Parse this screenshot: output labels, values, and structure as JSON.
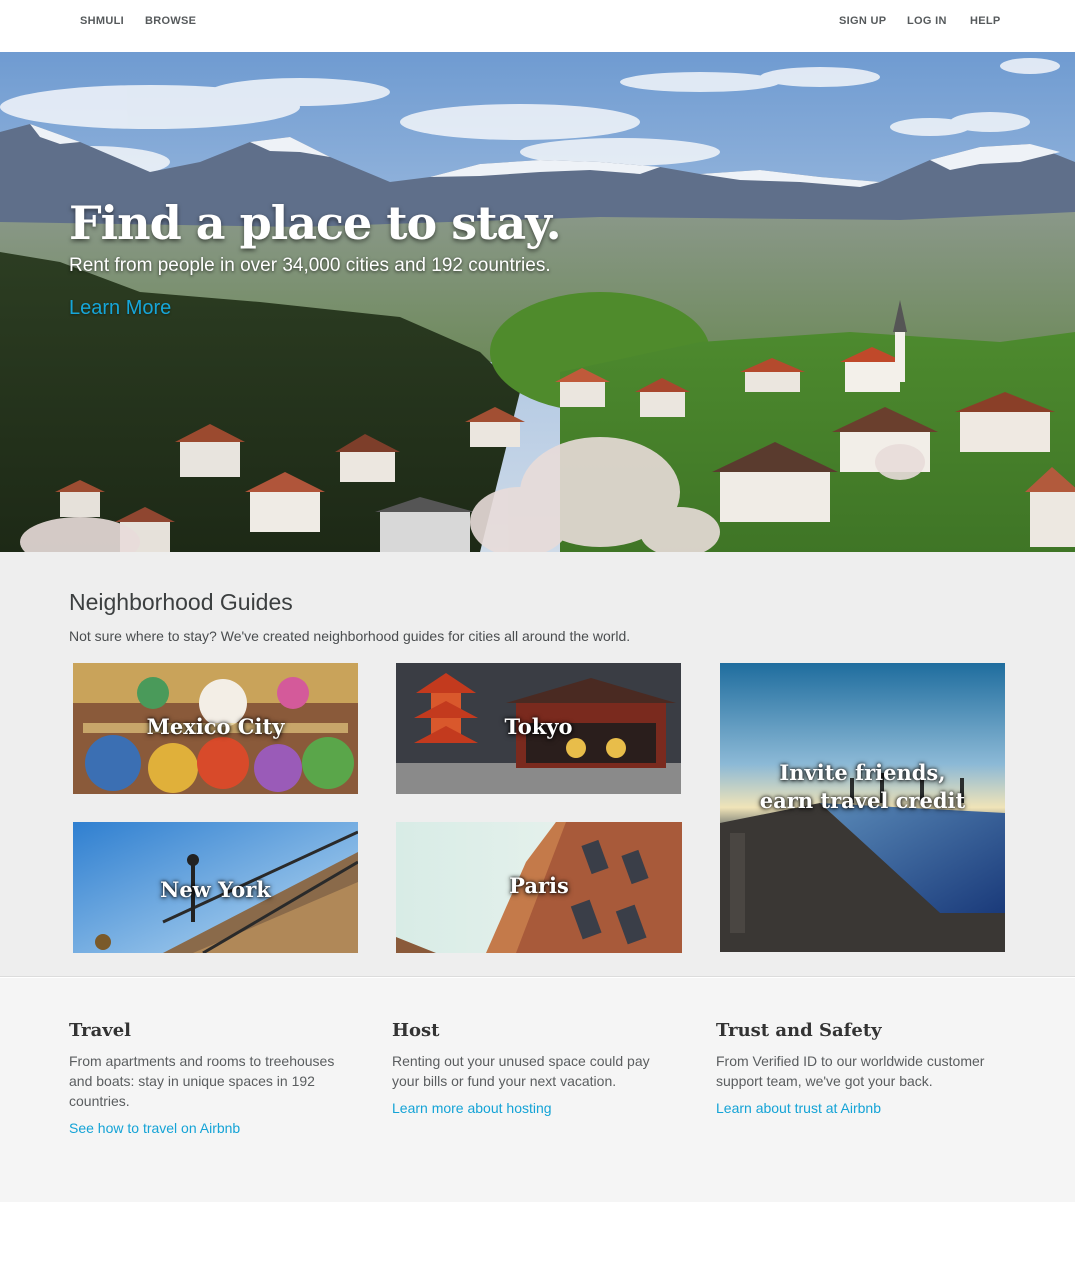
{
  "nav": {
    "left": [
      {
        "label": "SHMULI"
      },
      {
        "label": "BROWSE"
      }
    ],
    "right": [
      {
        "label": "SIGN UP"
      },
      {
        "label": "LOG IN"
      },
      {
        "label": "HELP"
      }
    ]
  },
  "hero": {
    "title": "Find a place to stay.",
    "subtitle": "Rent from people in over 34,000 cities and 192 countries.",
    "link": "Learn More"
  },
  "guides": {
    "title": "Neighborhood Guides",
    "description": "Not sure where to stay? We've created neighborhood guides for cities all around the world.",
    "cities": [
      {
        "label": "Mexico City"
      },
      {
        "label": "Tokyo"
      },
      {
        "label": "New York"
      },
      {
        "label": "Paris"
      }
    ],
    "invite": {
      "line1": "Invite friends,",
      "line2": "earn travel credit"
    }
  },
  "info": [
    {
      "title": "Travel",
      "text": "From apartments and rooms to treehouses and boats: stay in unique spaces in 192 countries.",
      "link": "See how to travel on Airbnb"
    },
    {
      "title": "Host",
      "text": "Renting out your unused space could pay your bills or fund your next vacation.",
      "link": "Learn more about hosting"
    },
    {
      "title": "Trust and Safety",
      "text": "From Verified ID to our worldwide customer support team, we've got your back.",
      "link": "Learn about trust at Airbnb"
    }
  ],
  "colors": {
    "link": "#16a6d9",
    "guides_bg": "#eeeeee",
    "info_bg": "#f5f5f5"
  }
}
